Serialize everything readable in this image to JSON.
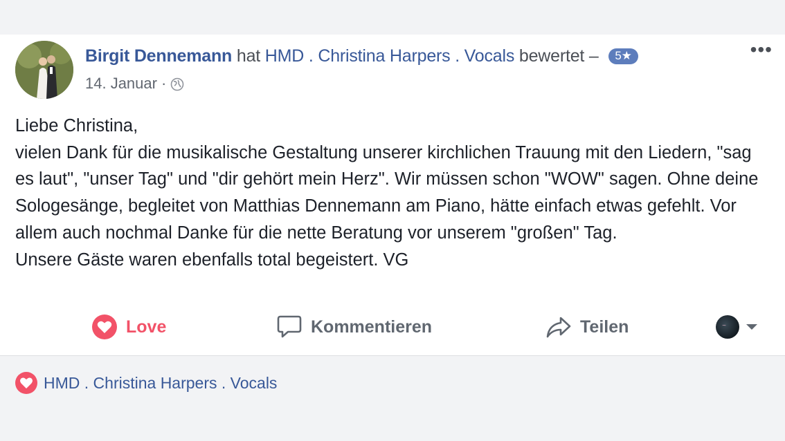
{
  "post": {
    "author": "Birgit Dennemann",
    "connector": "hat",
    "page_name": "HMD . Christina Harpers . Vocals",
    "action": "bewertet –",
    "rating": "5★",
    "date": "14. Januar",
    "date_separator": "·",
    "privacy_icon": "globe-icon",
    "more_icon": "•••",
    "body": [
      "Liebe Christina,",
      "vielen Dank für die musikalische Gestaltung unserer kirchlichen Trauung mit den Liedern, \"sag es laut\", \"unser Tag\" und \"dir gehört mein Herz\". Wir müssen schon \"WOW\" sagen. Ohne deine Sologesänge, begleitet von Matthias Dennemann am Piano, hätte einfach etwas gefehlt. Vor allem auch nochmal Danke für die nette Beratung vor unserem \"großen\" Tag.",
      "Unsere Gäste waren ebenfalls total begeistert. VG"
    ]
  },
  "actions": {
    "love_label": "Love",
    "comment_label": "Kommentieren",
    "share_label": "Teilen"
  },
  "footer": {
    "reaction_by": "HMD . Christina Harpers . Vocals"
  },
  "colors": {
    "link": "#385898",
    "love": "#f25268",
    "badge": "#5d7dbc",
    "muted": "#606770",
    "background": "#f2f3f5"
  }
}
